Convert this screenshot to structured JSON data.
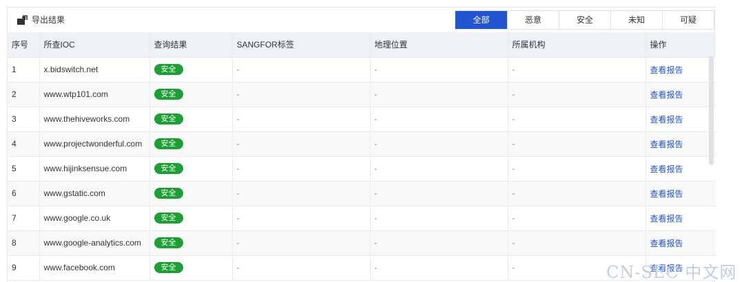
{
  "toolbar": {
    "export_label": "导出结果",
    "export_icon": "export-icon"
  },
  "filters": [
    {
      "label": "全部",
      "active": true
    },
    {
      "label": "恶意",
      "active": false
    },
    {
      "label": "安全",
      "active": false
    },
    {
      "label": "未知",
      "active": false
    },
    {
      "label": "可疑",
      "active": false
    }
  ],
  "table": {
    "columns": [
      "序号",
      "所查IOC",
      "查询结果",
      "SANGFOR标签",
      "地理位置",
      "所属机构",
      "操作"
    ],
    "rows": [
      {
        "index": "1",
        "ioc": "x.bidswitch.net",
        "result": "安全",
        "tag": "-",
        "location": "-",
        "org": "-",
        "action": "查看报告"
      },
      {
        "index": "2",
        "ioc": "www.wtp101.com",
        "result": "安全",
        "tag": "-",
        "location": "-",
        "org": "-",
        "action": "查看报告"
      },
      {
        "index": "3",
        "ioc": "www.thehiveworks.com",
        "result": "安全",
        "tag": "-",
        "location": "-",
        "org": "-",
        "action": "查看报告"
      },
      {
        "index": "4",
        "ioc": "www.projectwonderful.com",
        "result": "安全",
        "tag": "-",
        "location": "-",
        "org": "-",
        "action": "查看报告"
      },
      {
        "index": "5",
        "ioc": "www.hijinksensue.com",
        "result": "安全",
        "tag": "-",
        "location": "-",
        "org": "-",
        "action": "查看报告"
      },
      {
        "index": "6",
        "ioc": "www.gstatic.com",
        "result": "安全",
        "tag": "-",
        "location": "-",
        "org": "-",
        "action": "查看报告"
      },
      {
        "index": "7",
        "ioc": "www.google.co.uk",
        "result": "安全",
        "tag": "-",
        "location": "-",
        "org": "-",
        "action": "查看报告"
      },
      {
        "index": "8",
        "ioc": "www.google-analytics.com",
        "result": "安全",
        "tag": "-",
        "location": "-",
        "org": "-",
        "action": "查看报告"
      },
      {
        "index": "9",
        "ioc": "www.facebook.com",
        "result": "安全",
        "tag": "-",
        "location": "-",
        "org": "-",
        "action": "查看报告"
      }
    ]
  },
  "colors": {
    "accent": "#2255d1",
    "safe_badge": "#1aa033",
    "header_bg": "#eef1f6"
  },
  "watermark": "CN-SEC 中文网"
}
